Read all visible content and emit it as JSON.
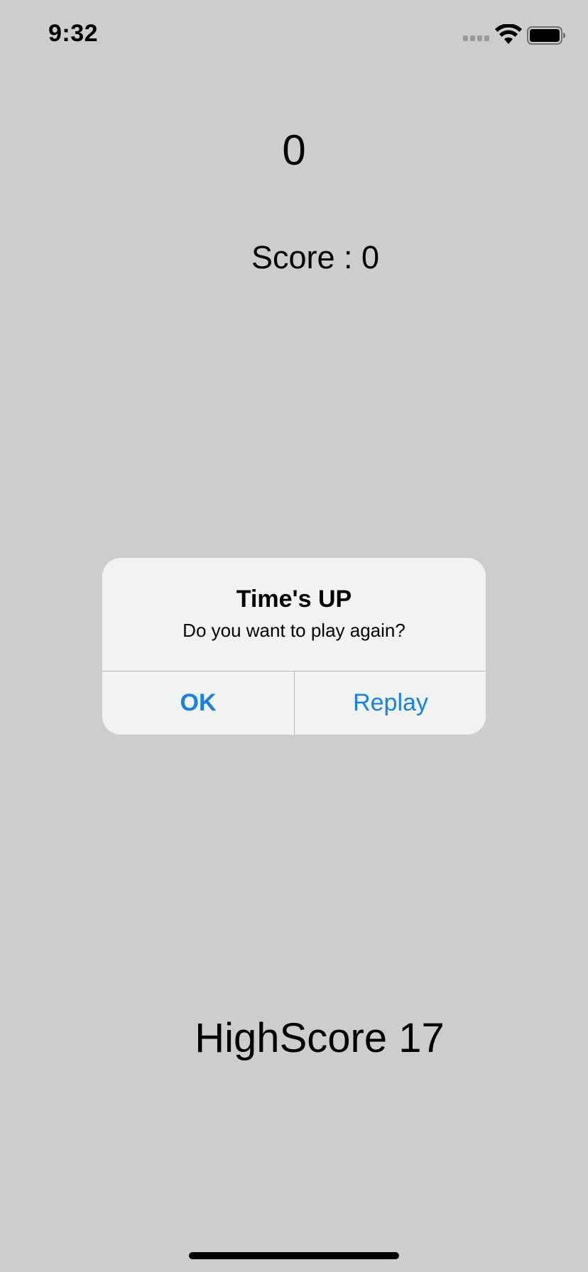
{
  "status_bar": {
    "time": "9:32",
    "icons": [
      "cellular-signal-icon",
      "wifi-icon",
      "battery-icon"
    ]
  },
  "game": {
    "timer": "0",
    "score": "Score : 0",
    "highscore": "HighScore 17"
  },
  "alert": {
    "title": "Time's UP",
    "message": "Do you want to play again?",
    "ok_label": "OK",
    "replay_label": "Replay"
  },
  "colors": {
    "background": "#cdcdcd",
    "alert_background": "#f1f2f2",
    "button_blue": "#1780ea"
  }
}
